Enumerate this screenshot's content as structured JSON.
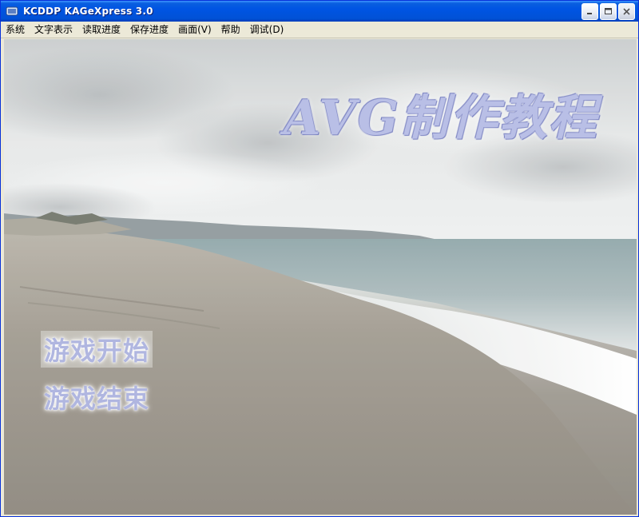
{
  "window": {
    "title": "KCDDP KAGeXpress 3.0",
    "title_color": "#0054e3"
  },
  "menubar": {
    "items": [
      {
        "label": "系统"
      },
      {
        "label": "文字表示"
      },
      {
        "label": "读取进度"
      },
      {
        "label": "保存进度"
      },
      {
        "label": "画面(V)"
      },
      {
        "label": "帮助"
      },
      {
        "label": "调试(D)"
      }
    ]
  },
  "game": {
    "logo": "AVG制作教程",
    "start_label": "游戏开始",
    "quit_label": "游戏结束",
    "logo_color": "#b9bfe6"
  }
}
